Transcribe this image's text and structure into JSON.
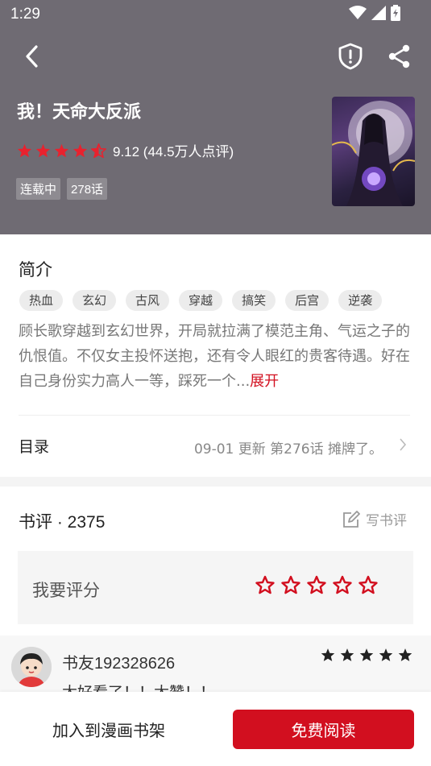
{
  "status_bar": {
    "time": "1:29",
    "icons": [
      "wifi-icon",
      "signal-icon",
      "battery-icon"
    ]
  },
  "nav": {
    "icons": [
      "back-arrow-icon",
      "shield-alert-icon",
      "share-icon"
    ]
  },
  "book": {
    "title": "我！天命大反派",
    "rating_text": "9.12 (44.5万人点评)",
    "rating_stars": 4.5,
    "badges": [
      "连载中",
      "278话"
    ]
  },
  "intro": {
    "title": "简介",
    "tags": [
      "热血",
      "玄幻",
      "古风",
      "穿越",
      "搞笑",
      "后宫",
      "逆袭"
    ],
    "description": "顾长歌穿越到玄幻世界，开局就拉满了模范主角、气运之子的仇恨值。不仅女主投怀送抱，还有令人眼红的贵客待遇。好在自己身份实力高人一等，踩死一个...",
    "expand_label": "展开"
  },
  "toc": {
    "label": "目录",
    "info": "09-01  更新  第276话 摊牌了。"
  },
  "reviews": {
    "title": "书评 · 2375",
    "write_label": "写书评",
    "rate_label": "我要评分",
    "comment": {
      "user": "书友192328626",
      "stars": 5,
      "text": "太好看了！！太赞！！"
    }
  },
  "bottom": {
    "add_label": "加入到漫画书架",
    "read_label": "免费阅读"
  },
  "colors": {
    "header_bg": "#6f6b73",
    "accent": "#d20f1f",
    "star_red": "#e8222e"
  }
}
